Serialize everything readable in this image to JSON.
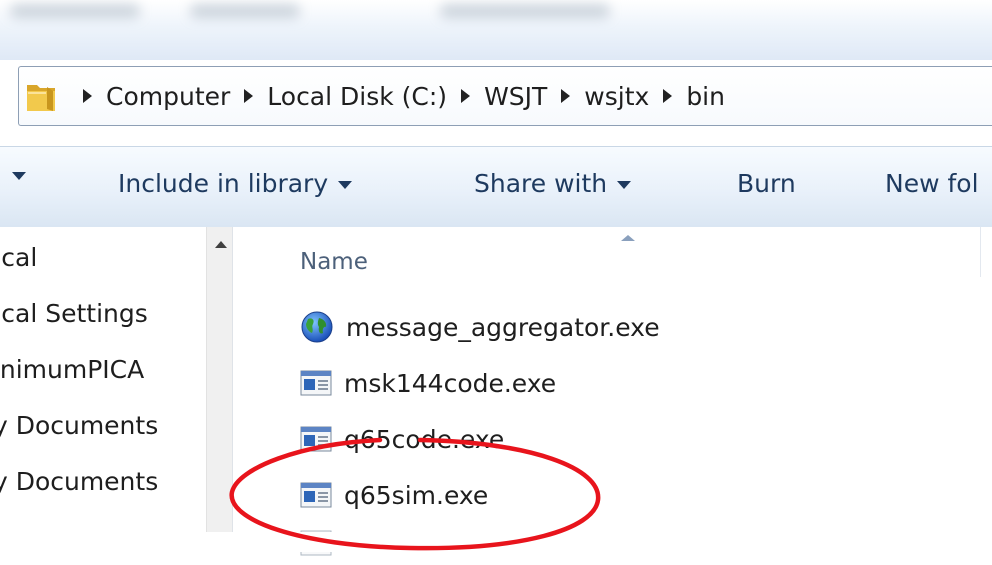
{
  "breadcrumbs": [
    "Computer",
    "Local Disk (C:)",
    "WSJT",
    "wsjtx",
    "bin"
  ],
  "toolbar": {
    "include_label": "Include in library",
    "share_label": "Share with",
    "burn_label": "Burn",
    "newfolder_label": "New fol"
  },
  "nav": {
    "items": [
      "ocal",
      "ocal Settings",
      "linimumPICA",
      "ly Documents",
      "ly Documents"
    ]
  },
  "filelist": {
    "column_header": "Name",
    "files": [
      {
        "name": "message_aggregator.exe",
        "icon": "globe-icon"
      },
      {
        "name": "msk144code.exe",
        "icon": "exe-icon"
      },
      {
        "name": "q65code.exe",
        "icon": "exe-icon"
      },
      {
        "name": "q65sim.exe",
        "icon": "exe-icon"
      }
    ]
  },
  "annotation": {
    "color": "#e8141c",
    "highlighted_file": "q65sim.exe"
  }
}
